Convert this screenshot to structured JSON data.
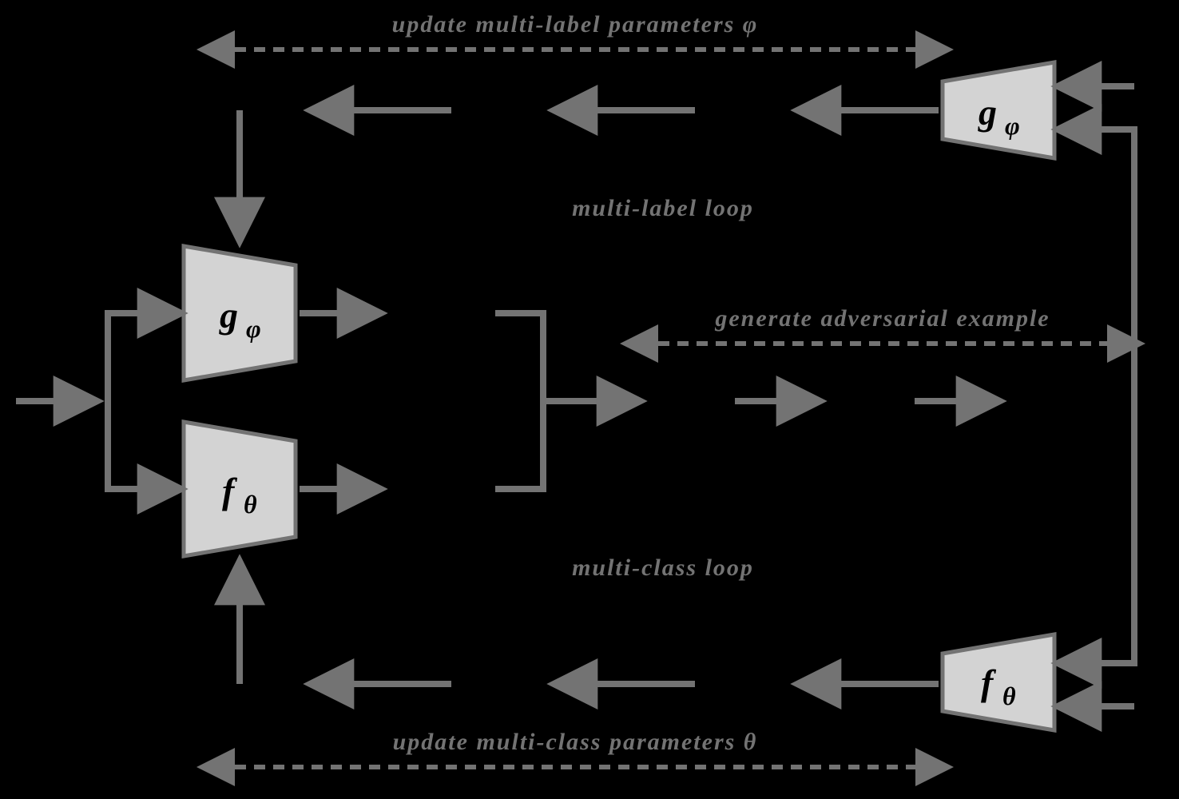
{
  "labels": {
    "update_phi": "update  multi-label  parameters  φ",
    "update_theta": "update  multi-class  parameters  θ",
    "multi_label_loop": "multi-label  loop",
    "multi_class_loop": "multi-class  loop",
    "gen_adv": "generate adversarial example"
  },
  "nodes": {
    "g_phi": "g",
    "g_phi_sub": "φ",
    "f_theta": "f",
    "f_theta_sub": "θ"
  },
  "colors": {
    "stroke": "#737373",
    "fill": "#d3d3d3",
    "text": "#737373"
  }
}
